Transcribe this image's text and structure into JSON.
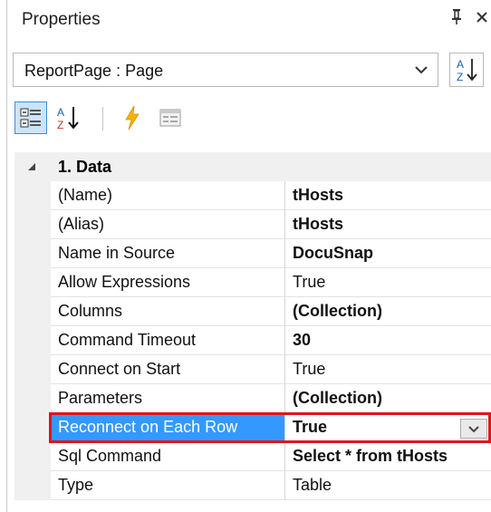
{
  "panel": {
    "title": "Properties",
    "pin_glyph": "ᵖ",
    "close_glyph": "×"
  },
  "object_selector": {
    "value": "ReportPage : Page"
  },
  "toolbar": {
    "buttons": [
      {
        "icon": "categorized-icon",
        "active": true
      },
      {
        "icon": "sort-alphabetical-icon",
        "active": false
      },
      {
        "icon": "events-lightning-icon",
        "active": false
      },
      {
        "icon": "property-pages-icon",
        "active": false
      }
    ]
  },
  "category": {
    "label": "1. Data",
    "expanded": true
  },
  "properties": [
    {
      "name": "(Name)",
      "value": "tHosts",
      "bold": true
    },
    {
      "name": "(Alias)",
      "value": "tHosts",
      "bold": true
    },
    {
      "name": "Name in Source",
      "value": "DocuSnap",
      "bold": true
    },
    {
      "name": "Allow Expressions",
      "value": "True",
      "bold": false
    },
    {
      "name": "Columns",
      "value": "(Collection)",
      "bold": true
    },
    {
      "name": "Command Timeout",
      "value": "30",
      "bold": true
    },
    {
      "name": "Connect on Start",
      "value": "True",
      "bold": false
    },
    {
      "name": "Parameters",
      "value": "(Collection)",
      "bold": true
    },
    {
      "name": "Reconnect on Each Row",
      "value": "True",
      "bold": true,
      "selected": true
    },
    {
      "name": "Sql Command",
      "value": "Select * from tHosts",
      "bold": true
    },
    {
      "name": "Type",
      "value": "Table",
      "bold": false
    }
  ],
  "colors": {
    "selection": "#3399ff",
    "highlight_outline": "#e0141b",
    "category_bg": "#f0f0f0"
  }
}
